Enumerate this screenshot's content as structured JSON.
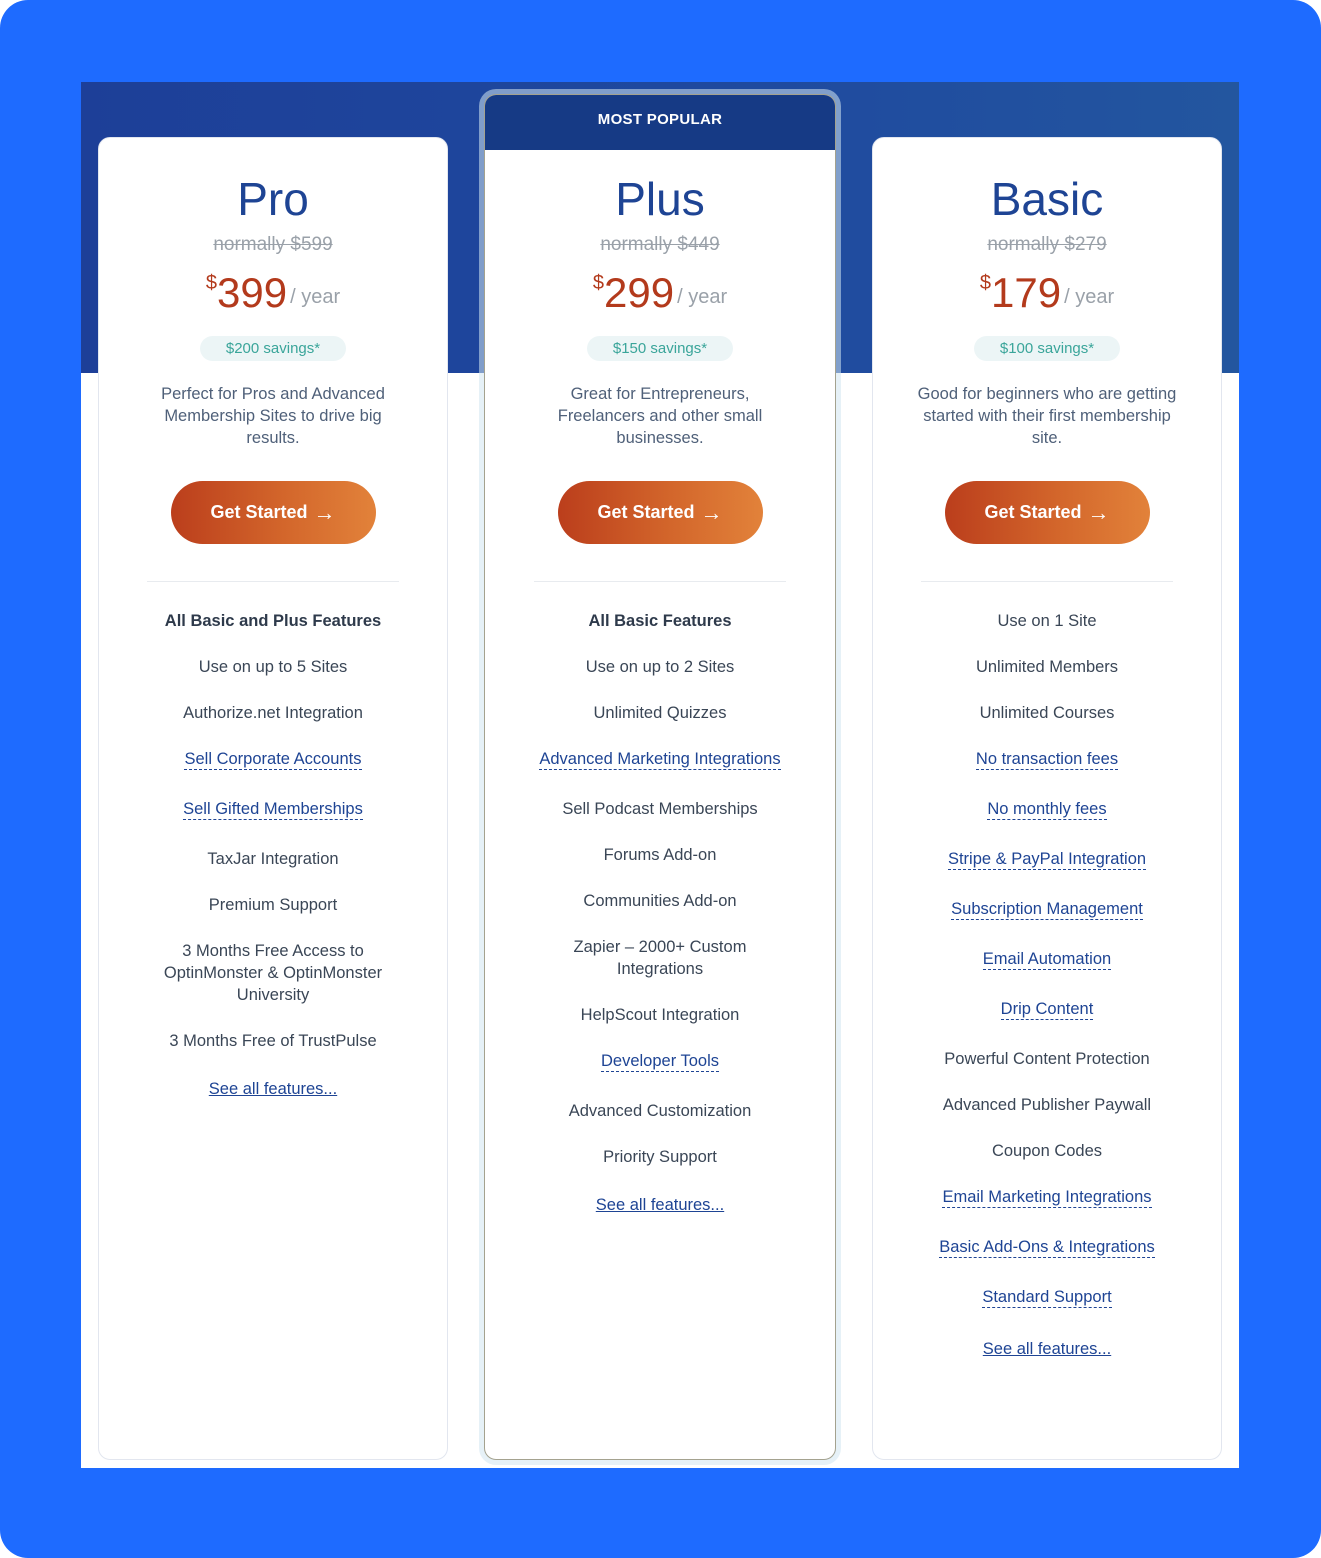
{
  "colors": {
    "frame": "#1e6bff",
    "band": "#1d3f98",
    "plan_name": "#1e4494",
    "price": "#b33a1c",
    "savings_text": "#3aa59a",
    "cta_start": "#bb3e1c",
    "cta_end": "#e2823a",
    "link": "#1e4494"
  },
  "plans": [
    {
      "name": "Pro",
      "normally": "normally $599",
      "currency": "$",
      "amount": "399",
      "period": "/ year",
      "savings": "$200 savings*",
      "description": "Perfect for Pros and Advanced Membership Sites to drive big results.",
      "cta": "Get Started",
      "features": [
        {
          "text": "All Basic and Plus Features",
          "style": "bold"
        },
        {
          "text": "Use on up to 5 Sites",
          "style": "plain"
        },
        {
          "text": "Authorize.net Integration",
          "style": "plain"
        },
        {
          "text": "Sell Corporate Accounts",
          "style": "link"
        },
        {
          "text": "Sell Gifted Memberships",
          "style": "link"
        },
        {
          "text": "TaxJar Integration",
          "style": "plain"
        },
        {
          "text": "Premium Support",
          "style": "plain"
        },
        {
          "text": "3 Months Free Access to OptinMonster & OptinMonster University",
          "style": "plain"
        },
        {
          "text": "3 Months Free of TrustPulse",
          "style": "plain"
        }
      ],
      "see_all": "See all features..."
    },
    {
      "badge": "MOST POPULAR",
      "name": "Plus",
      "normally": "normally $449",
      "currency": "$",
      "amount": "299",
      "period": "/ year",
      "savings": "$150 savings*",
      "description": "Great for Entrepreneurs, Freelancers and other small businesses.",
      "cta": "Get Started",
      "features": [
        {
          "text": "All Basic Features",
          "style": "bold"
        },
        {
          "text": "Use on up to 2 Sites",
          "style": "plain"
        },
        {
          "text": "Unlimited Quizzes",
          "style": "plain"
        },
        {
          "text": "Advanced Marketing Integrations",
          "style": "link"
        },
        {
          "text": "Sell Podcast Memberships",
          "style": "plain"
        },
        {
          "text": "Forums Add-on",
          "style": "plain"
        },
        {
          "text": "Communities Add-on",
          "style": "plain"
        },
        {
          "text": "Zapier – 2000+ Custom Integrations",
          "style": "plain"
        },
        {
          "text": "HelpScout Integration",
          "style": "plain"
        },
        {
          "text": "Developer Tools",
          "style": "link"
        },
        {
          "text": "Advanced Customization",
          "style": "plain"
        },
        {
          "text": "Priority Support",
          "style": "plain"
        }
      ],
      "see_all": "See all features..."
    },
    {
      "name": "Basic",
      "normally": "normally $279",
      "currency": "$",
      "amount": "179",
      "period": "/ year",
      "savings": "$100 savings*",
      "description": "Good for beginners who are getting started with their first membership site.",
      "cta": "Get Started",
      "features": [
        {
          "text": "Use on 1 Site",
          "style": "plain"
        },
        {
          "text": "Unlimited Members",
          "style": "plain"
        },
        {
          "text": "Unlimited Courses",
          "style": "plain"
        },
        {
          "text": "No transaction fees",
          "style": "link"
        },
        {
          "text": "No monthly fees",
          "style": "link"
        },
        {
          "text": "Stripe & PayPal Integration",
          "style": "link"
        },
        {
          "text": "Subscription Management",
          "style": "link"
        },
        {
          "text": "Email Automation",
          "style": "link"
        },
        {
          "text": "Drip Content",
          "style": "link"
        },
        {
          "text": "Powerful Content Protection",
          "style": "plain"
        },
        {
          "text": "Advanced Publisher Paywall",
          "style": "plain"
        },
        {
          "text": "Coupon Codes",
          "style": "plain"
        },
        {
          "text": "Email Marketing Integrations",
          "style": "link"
        },
        {
          "text": "Basic Add-Ons & Integrations",
          "style": "link"
        },
        {
          "text": "Standard Support",
          "style": "link"
        }
      ],
      "see_all": "See all features..."
    }
  ]
}
